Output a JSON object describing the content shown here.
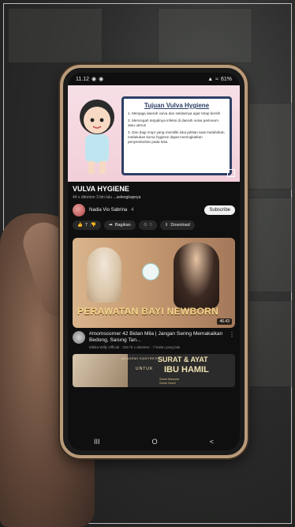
{
  "status_bar": {
    "time": "11.12",
    "battery": "61%"
  },
  "video": {
    "card_title": "Tujuan Vulva Hygiene",
    "card_items": [
      "1. Menjaga daerah vulva dan sekitarnya agar tetap bersih",
      "2. Mencegah terjadinya infeksi di daerah vulva perineum atau uterus",
      "3. Dan bagi mopr yang memiliki luka jahitan saat melahirkan melakukan kurva hygiene dapat meningkatkan penyembuhan pada luka"
    ],
    "title": "VULVA HYGIENE",
    "views_prefix": "44 x ditonton  3 bln lalu",
    "more_label": "...selengkapnya",
    "channel_name": "Nadia Vio Sabrina",
    "channel_count": "4",
    "subscribe_label": "Subscribe",
    "like_count": "7",
    "share_label": "Bagikan",
    "remix_label": "0",
    "download_label": "Download"
  },
  "recommendation_1": {
    "thumbnail_text": "PERAWATAN BAYI NEWBORN",
    "duration": "46.43",
    "title": "#momscorner 42 Bidan Mila | Jangan Sering Memakaikan Bedong, Sarung Tan...",
    "subtitle": "Mikita Willy Official · 332 rb x ditonton · 7 bulan yang lalu"
  },
  "recommendation_2": {
    "brand": "AKADEMI KANTRESI",
    "line1": "SURAT & AYAT",
    "untuk": "UNTUK",
    "line2": "IBU HAMIL",
    "small_lines": [
      "Surat Maryam",
      "Surat Yusuf"
    ]
  },
  "navbar": {
    "recents": "III",
    "home": "O",
    "back": "<"
  }
}
